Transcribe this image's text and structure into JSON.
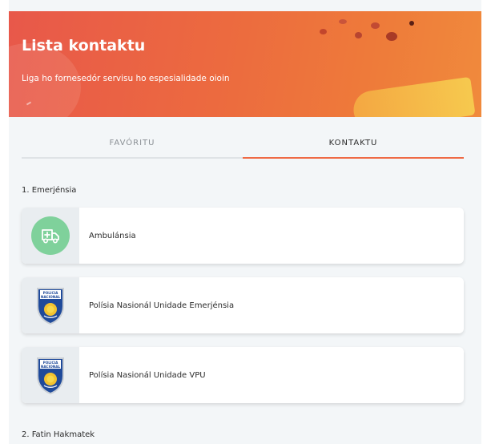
{
  "header": {
    "title": "Lista kontaktu",
    "subtitle": "Liga ho fornesedór servisu ho espesialidade oioin"
  },
  "tabs": [
    {
      "label": "FAVÓRITU",
      "active": false
    },
    {
      "label": "KONTAKTU",
      "active": true
    }
  ],
  "sections": [
    {
      "title": "1. Emerjénsia",
      "items": [
        {
          "label": "Ambulánsia",
          "icon": "ambulance-icon"
        },
        {
          "label": "Polísia Nasionál Unidade Emerjénsia",
          "icon": "police-badge-icon"
        },
        {
          "label": "Polísia Nasionál Unidade VPU",
          "icon": "police-badge-icon"
        }
      ]
    },
    {
      "title": "2. Fatin Hakmatek",
      "items": []
    }
  ],
  "badge_text": {
    "line1": "POLICIA",
    "line2": "NACIONAL"
  },
  "colors": {
    "header_start": "#e8584a",
    "header_end": "#f08a3c",
    "active_tab_underline": "#ef6a45",
    "ambulance_circle": "#7fd19b"
  }
}
